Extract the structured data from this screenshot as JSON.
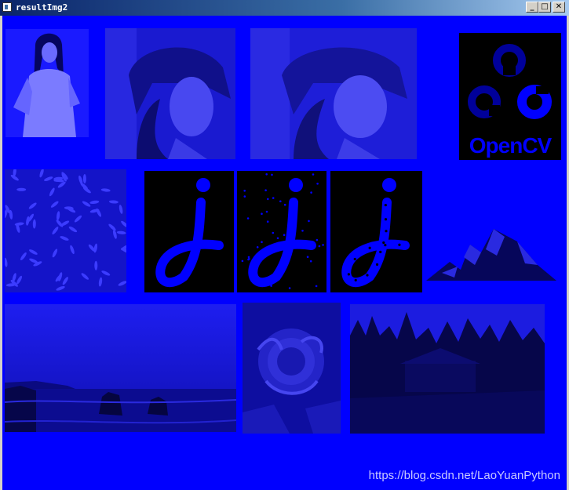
{
  "window": {
    "title": "resultImg2",
    "buttons": {
      "minimize": "_",
      "maximize": "□",
      "close": "✕"
    }
  },
  "watermark": "https://blog.csdn.net/LaoYuanPython",
  "opencv_logo": {
    "text": "OpenCV"
  },
  "colors": {
    "background": "#0000ff",
    "dark_fill": "#000000",
    "titlebar_start": "#0a246a"
  },
  "tiles": [
    {
      "name": "woman-portrait-image"
    },
    {
      "name": "lena-image-1"
    },
    {
      "name": "lena-image-2"
    },
    {
      "name": "opencv-logo-image"
    },
    {
      "name": "rice-grains-image"
    },
    {
      "name": "letter-j-image-1"
    },
    {
      "name": "letter-j-noise-image"
    },
    {
      "name": "letter-j-holes-image"
    },
    {
      "name": "mountain-icon-image"
    },
    {
      "name": "seascape-image"
    },
    {
      "name": "flower-image"
    },
    {
      "name": "forest-house-image"
    }
  ]
}
